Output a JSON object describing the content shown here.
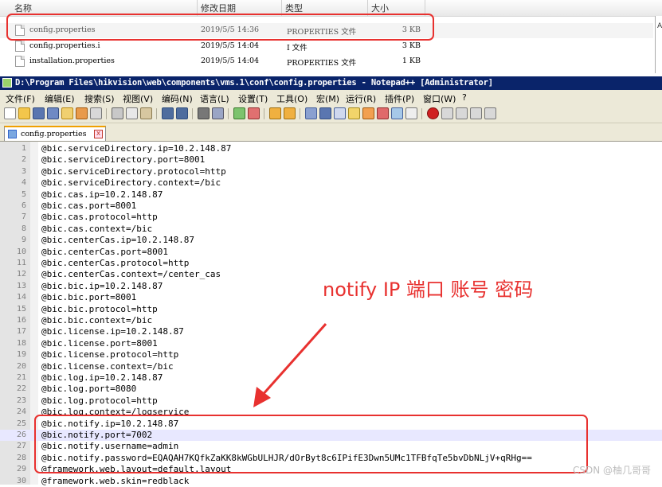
{
  "explorer": {
    "columns": {
      "name": "名称",
      "date": "修改日期",
      "type": "类型",
      "size": "大小"
    },
    "files": [
      {
        "name": "config.properties",
        "date": "2019/5/5 14:36",
        "type": "PROPERTIES 文件",
        "size": "3 KB"
      },
      {
        "name": "config.properties.i",
        "date": "2019/5/5 14:04",
        "type": "I 文件",
        "size": "3 KB"
      },
      {
        "name": "installation.properties",
        "date": "2019/5/5 14:04",
        "type": "PROPERTIES 文件",
        "size": "1 KB"
      }
    ],
    "edge_char": "A"
  },
  "notepad": {
    "title": "D:\\Program Files\\hikvision\\web\\components\\vms.1\\conf\\config.properties - Notepad++ [Administrator]",
    "menu": [
      "文件(F)",
      "编辑(E)",
      "搜索(S)",
      "视图(V)",
      "编码(N)",
      "语言(L)",
      "设置(T)",
      "工具(O)",
      "宏(M)",
      "运行(R)",
      "插件(P)",
      "窗口(W)",
      "?"
    ],
    "tab": {
      "label": "config.properties",
      "close": "x"
    },
    "current_line": 26,
    "lines": [
      {
        "n": "1",
        "text": "@bic.serviceDirectory.ip=10.2.148.87"
      },
      {
        "n": "2",
        "text": "@bic.serviceDirectory.port=8001"
      },
      {
        "n": "3",
        "text": "@bic.serviceDirectory.protocol=http"
      },
      {
        "n": "4",
        "text": "@bic.serviceDirectory.context=/bic"
      },
      {
        "n": "5",
        "text": "@bic.cas.ip=10.2.148.87"
      },
      {
        "n": "6",
        "text": "@bic.cas.port=8001"
      },
      {
        "n": "7",
        "text": "@bic.cas.protocol=http"
      },
      {
        "n": "8",
        "text": "@bic.cas.context=/bic"
      },
      {
        "n": "9",
        "text": "@bic.centerCas.ip=10.2.148.87"
      },
      {
        "n": "10",
        "text": "@bic.centerCas.port=8001"
      },
      {
        "n": "11",
        "text": "@bic.centerCas.protocol=http"
      },
      {
        "n": "12",
        "text": "@bic.centerCas.context=/center_cas"
      },
      {
        "n": "13",
        "text": "@bic.bic.ip=10.2.148.87"
      },
      {
        "n": "14",
        "text": "@bic.bic.port=8001"
      },
      {
        "n": "15",
        "text": "@bic.bic.protocol=http"
      },
      {
        "n": "16",
        "text": "@bic.bic.context=/bic"
      },
      {
        "n": "17",
        "text": "@bic.license.ip=10.2.148.87"
      },
      {
        "n": "18",
        "text": "@bic.license.port=8001"
      },
      {
        "n": "19",
        "text": "@bic.license.protocol=http"
      },
      {
        "n": "20",
        "text": "@bic.license.context=/bic"
      },
      {
        "n": "21",
        "text": "@bic.log.ip=10.2.148.87"
      },
      {
        "n": "22",
        "text": "@bic.log.port=8080"
      },
      {
        "n": "23",
        "text": "@bic.log.protocol=http"
      },
      {
        "n": "24",
        "text": "@bic.log.context=/logservice"
      },
      {
        "n": "25",
        "text": "@bic.notify.ip=10.2.148.87"
      },
      {
        "n": "26",
        "text": "@bic.notify.port=7002"
      },
      {
        "n": "27",
        "text": "@bic.notify.username=admin"
      },
      {
        "n": "28",
        "text": "@bic.notify.password=EQAQAH7KQfkZaKK8kWGbULHJR/dOrByt8c6IPifE3Dwn5UMc1TFBfqTe5bvDbNLjV+qRHg=="
      },
      {
        "n": "29",
        "text": "@framework.web.layout=default.layout"
      },
      {
        "n": "30",
        "text": "@framework.web.skin=redblack"
      }
    ]
  },
  "annotation": {
    "text": "notify IP 端口 账号 密码",
    "color": "#e8312f"
  },
  "watermark": "CSDN @柚几哥哥"
}
